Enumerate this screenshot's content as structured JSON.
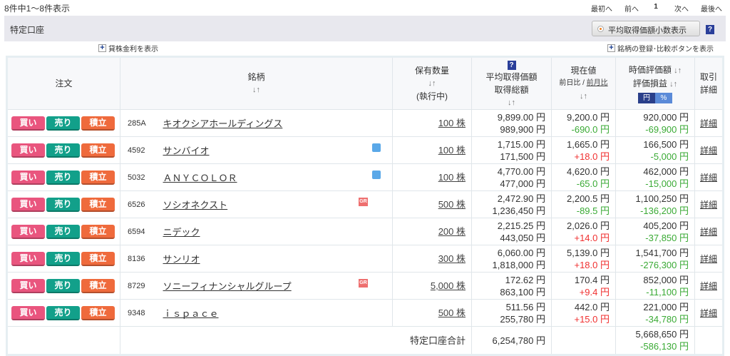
{
  "header": {
    "count": "8件中1～8件表示",
    "pager": [
      "最初へ",
      "前へ",
      "1",
      "次へ",
      "最後へ"
    ]
  },
  "account": {
    "title": "特定口座",
    "decimal_button": "平均取得価額小数表示",
    "help": "?"
  },
  "links": {
    "lending": "貸株金利を表示",
    "register": "銘柄の登録･比較ボタンを表示"
  },
  "columns": {
    "order": "注文",
    "name": "銘柄",
    "qty": "保有数量",
    "qty_sub": "(執行中)",
    "avg": "平均取得価額",
    "total": "取得総額",
    "price": "現在値",
    "dayratio": "前日比",
    "slash": " / ",
    "monthratio": "前月比",
    "value": "時価評価額",
    "pl": "評価損益",
    "yen": "円",
    "pct": "%",
    "detail1": "取引",
    "detail2": "詳細",
    "sort": "↓↑",
    "help": "?"
  },
  "buttons": {
    "buy": "買い",
    "sell": "売り",
    "accum": "積立"
  },
  "rows": [
    {
      "code": "285A",
      "name": "キオクシアホールディングス",
      "icon": "",
      "qty": "100 株",
      "avg": "9,899.00 円",
      "total": "989,900 円",
      "price": "9,200.0 円",
      "change": "-690.0 円",
      "value": "920,000 円",
      "pl": "-69,900 円",
      "detail": "詳細"
    },
    {
      "code": "4592",
      "name": "サンバイオ",
      "icon": "calendar",
      "qty": "100 株",
      "avg": "1,715.00 円",
      "total": "171,500 円",
      "price": "1,665.0 円",
      "change": "+18.0 円",
      "value": "166,500 円",
      "pl": "-5,000 円",
      "detail": "詳細"
    },
    {
      "code": "5032",
      "name": "ＡＮＹＣＯＬＯＲ",
      "icon": "calendar",
      "qty": "100 株",
      "avg": "4,770.00 円",
      "total": "477,000 円",
      "price": "4,620.0 円",
      "change": "-65.0 円",
      "value": "462,000 円",
      "pl": "-15,000 円",
      "detail": "詳細"
    },
    {
      "code": "6526",
      "name": "ソシオネクスト",
      "icon": "GR",
      "qty": "500 株",
      "avg": "2,472.90 円",
      "total": "1,236,450 円",
      "price": "2,200.5 円",
      "change": "-89.5 円",
      "value": "1,100,250 円",
      "pl": "-136,200 円",
      "detail": "詳細"
    },
    {
      "code": "6594",
      "name": "ニデック",
      "icon": "",
      "qty": "200 株",
      "avg": "2,215.25 円",
      "total": "443,050 円",
      "price": "2,026.0 円",
      "change": "+14.0 円",
      "value": "405,200 円",
      "pl": "-37,850 円",
      "detail": "詳細"
    },
    {
      "code": "8136",
      "name": "サンリオ",
      "icon": "",
      "qty": "300 株",
      "avg": "6,060.00 円",
      "total": "1,818,000 円",
      "price": "5,139.0 円",
      "change": "+18.0 円",
      "value": "1,541,700 円",
      "pl": "-276,300 円",
      "detail": "詳細"
    },
    {
      "code": "8729",
      "name": "ソニーフィナンシャルグループ",
      "icon": "GR",
      "qty": "5,000 株",
      "avg": "172.62 円",
      "total": "863,100 円",
      "price": "170.4 円",
      "change": "+9.4 円",
      "value": "852,000 円",
      "pl": "-11,100 円",
      "detail": "詳細"
    },
    {
      "code": "9348",
      "name": "ｉｓｐａｃｅ",
      "icon": "",
      "qty": "500 株",
      "avg": "511.56 円",
      "total": "255,780 円",
      "price": "442.0 円",
      "change": "+15.0 円",
      "value": "221,000 円",
      "pl": "-34,780 円",
      "detail": "詳細"
    }
  ],
  "summary": {
    "label": "特定口座合計",
    "total": "6,254,780 円",
    "value": "5,668,650 円",
    "pl": "-586,130 円"
  },
  "colors": {
    "buy": "#e9557e",
    "sell": "#12a08a",
    "accum": "#ef6a3c",
    "negative": "#3aaa35",
    "positive": "#f03030"
  }
}
